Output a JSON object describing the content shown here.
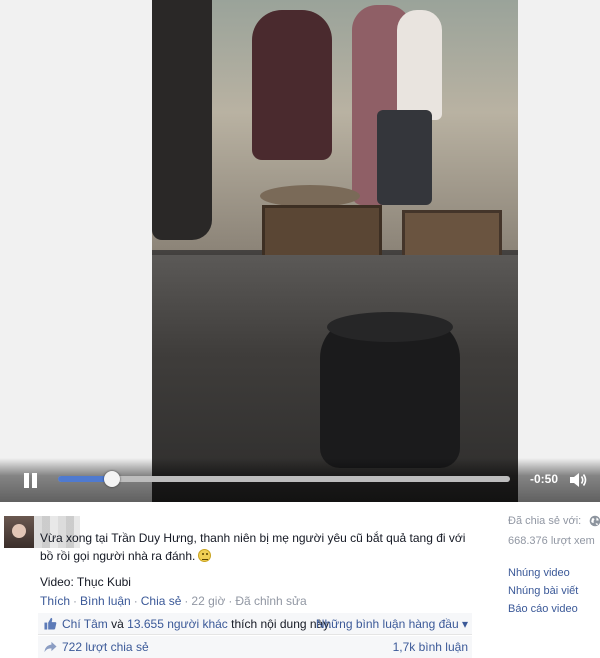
{
  "video": {
    "time_remaining": "-0:50",
    "progress_fraction": 0.12,
    "pause_icon": "pause-icon",
    "volume_icon": "volume-icon"
  },
  "post": {
    "text": "Vừa xong tại Trần Duy Hưng, thanh niên bị mẹ người yêu cũ bắt quả tang đi với bồ rồi gọi người nhà ra đánh.",
    "emoji": "smile-emoji",
    "credit": "Video: Thục Kubi",
    "actions": {
      "like": "Thích",
      "comment": "Bình luận",
      "share": "Chia sẻ",
      "time": "22 giờ",
      "edited": "Đã chỉnh sửa"
    },
    "likes": {
      "name": "Chí Tâm",
      "connector": "và",
      "others": "13.655 người khác",
      "suffix": "thích nội dung này.",
      "sort_label": "Những bình luận hàng đầu ▾"
    },
    "shares": {
      "count_label": "722 lượt chia sẻ",
      "comments_label": "1,7k bình luận"
    }
  },
  "sidebar": {
    "shared_with": "Đã chia sẻ với:",
    "views": "668.376 lượt xem",
    "links": [
      "Nhúng video",
      "Nhúng bài viết",
      "Báo cáo video"
    ]
  },
  "colors": {
    "link": "#3b5998",
    "muted": "#9197a3",
    "progress": "#4f7ad0"
  }
}
